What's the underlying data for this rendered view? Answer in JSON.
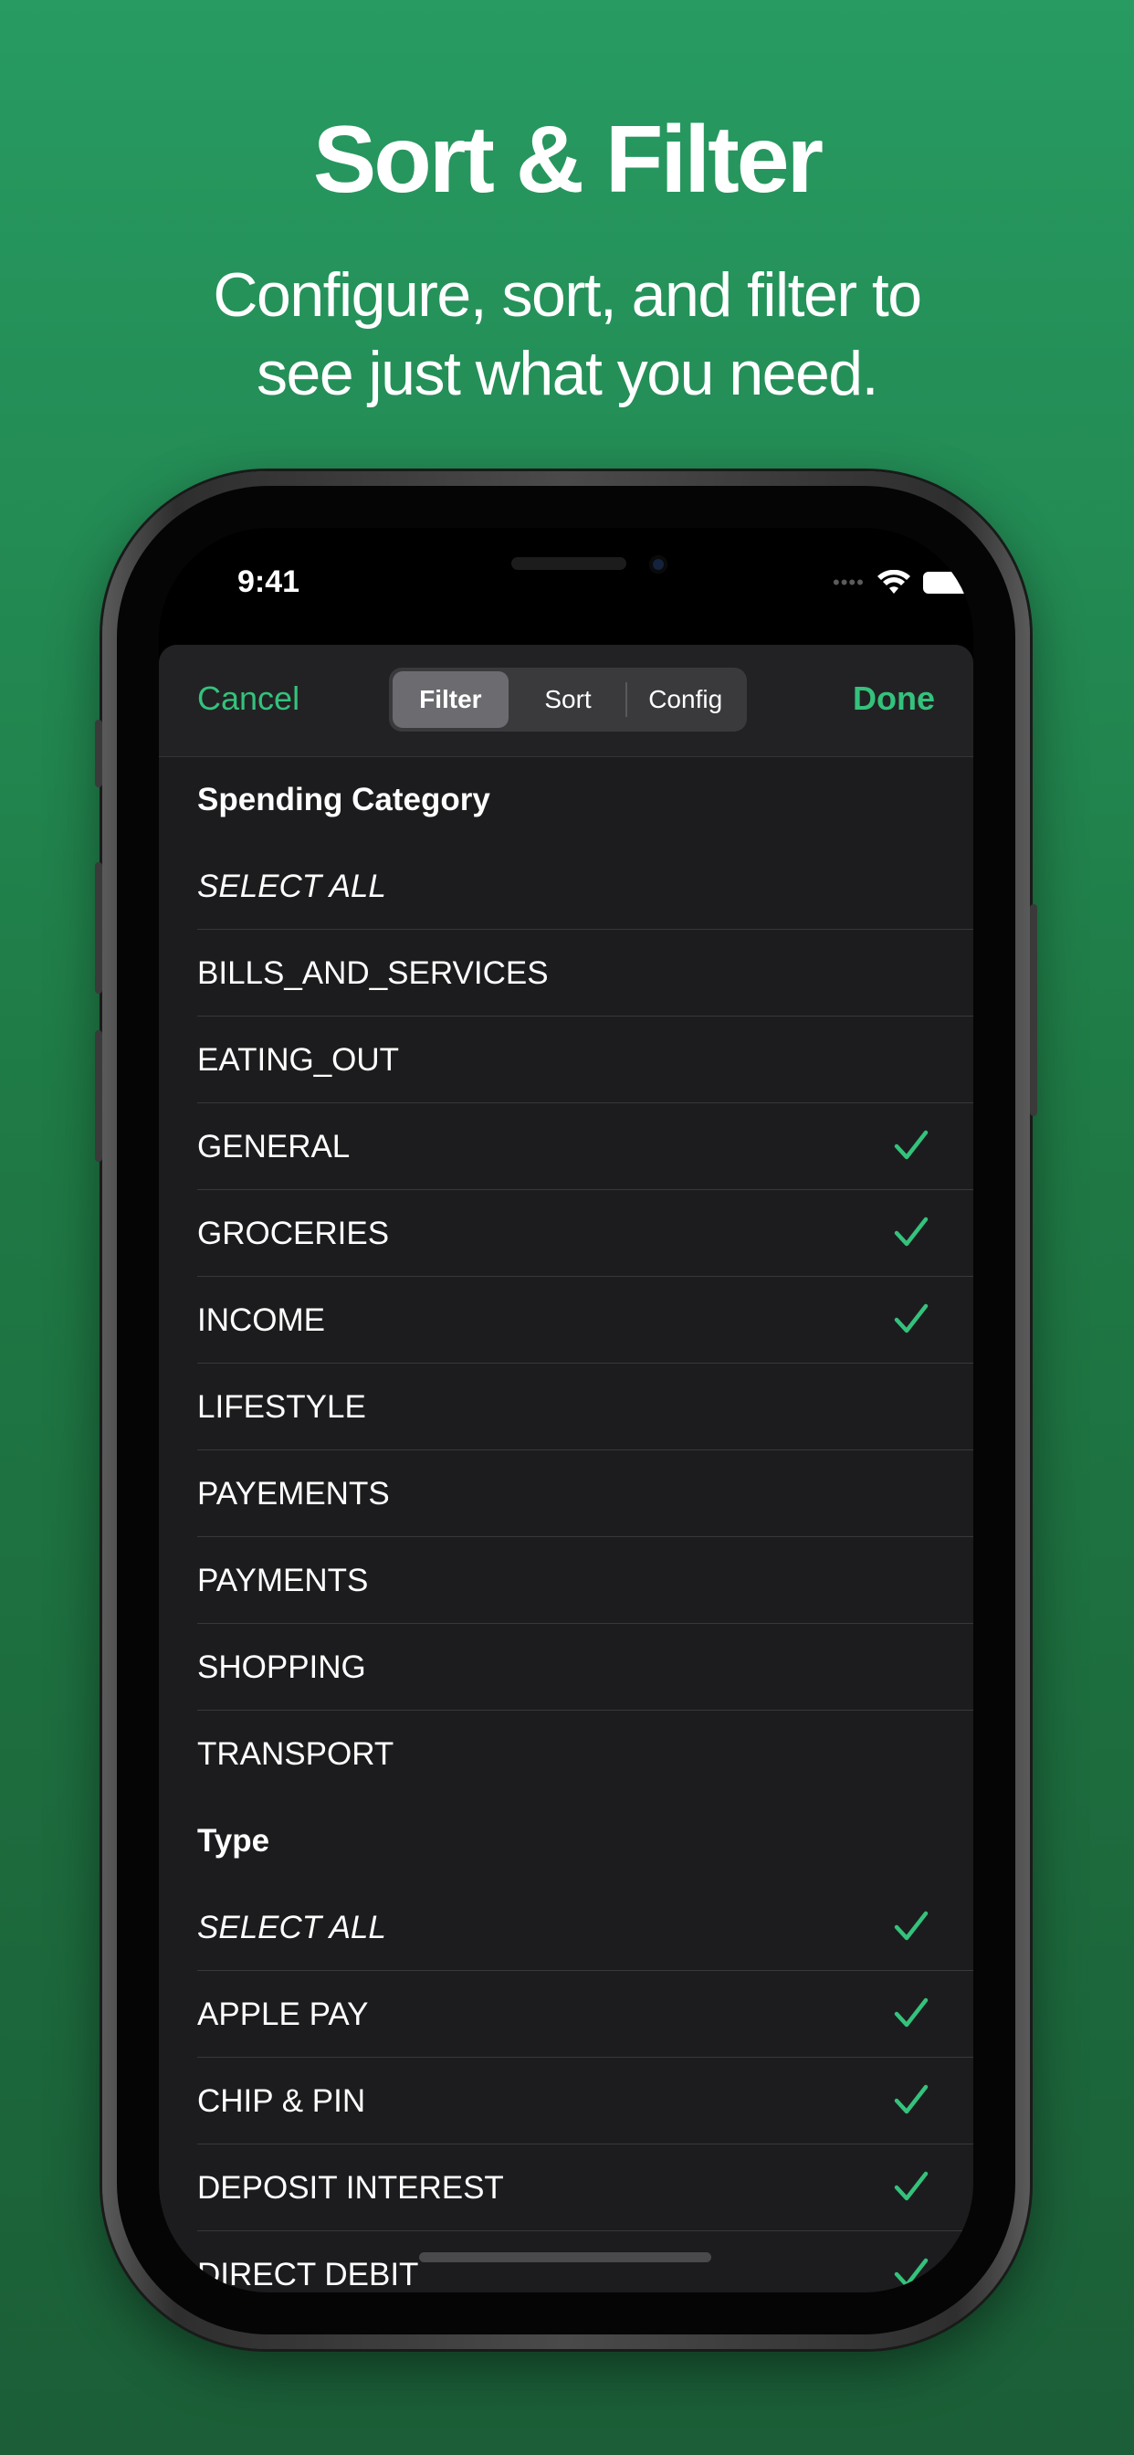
{
  "promo": {
    "headline": "Sort & Filter",
    "subheadline_line1": "Configure, sort, and filter to",
    "subheadline_line2": "see just what you need."
  },
  "status_bar": {
    "time": "9:41",
    "icons": [
      "signal-icon",
      "wifi-icon",
      "battery-icon"
    ]
  },
  "nav": {
    "cancel_label": "Cancel",
    "done_label": "Done",
    "segments": [
      {
        "label": "Filter",
        "selected": true
      },
      {
        "label": "Sort",
        "selected": false
      },
      {
        "label": "Config",
        "selected": false
      }
    ]
  },
  "colors": {
    "accent": "#34c27c",
    "background_top": "#279b62",
    "background_bottom": "#1b5e37",
    "sheet": "#1c1c1e"
  },
  "sections": [
    {
      "title": "Spending Category",
      "rows": [
        {
          "label": "SELECT ALL",
          "checked": false,
          "italic": true
        },
        {
          "label": "BILLS_AND_SERVICES",
          "checked": false
        },
        {
          "label": "EATING_OUT",
          "checked": false
        },
        {
          "label": "GENERAL",
          "checked": true
        },
        {
          "label": "GROCERIES",
          "checked": true
        },
        {
          "label": "INCOME",
          "checked": true
        },
        {
          "label": "LIFESTYLE",
          "checked": false
        },
        {
          "label": "PAYEMENTS",
          "checked": false
        },
        {
          "label": "PAYMENTS",
          "checked": false
        },
        {
          "label": "SHOPPING",
          "checked": false
        },
        {
          "label": "TRANSPORT",
          "checked": false
        }
      ]
    },
    {
      "title": "Type",
      "rows": [
        {
          "label": "SELECT ALL",
          "checked": true,
          "italic": true
        },
        {
          "label": "APPLE PAY",
          "checked": true
        },
        {
          "label": "CHIP & PIN",
          "checked": true
        },
        {
          "label": "DEPOSIT INTEREST",
          "checked": true
        },
        {
          "label": "DIRECT DEBIT",
          "checked": true
        }
      ]
    }
  ]
}
